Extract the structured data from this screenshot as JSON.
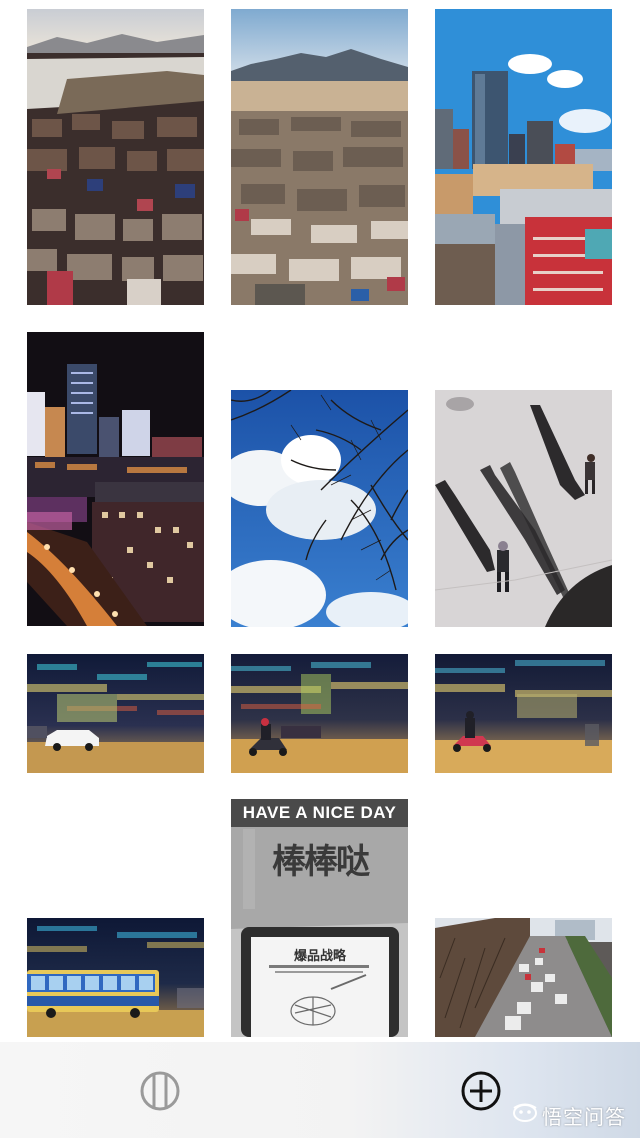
{
  "photos": [
    {
      "id": "photo-1",
      "subject": "aerial view of village rooftops by river"
    },
    {
      "id": "photo-2",
      "subject": "aerial view of town with mountains"
    },
    {
      "id": "photo-3",
      "subject": "city towers under blue sky"
    },
    {
      "id": "photo-4",
      "subject": "city street at night"
    },
    {
      "id": "photo-5",
      "subject": "bare tree branches against clouds"
    },
    {
      "id": "photo-6",
      "subject": "pedestrians with long shadows"
    },
    {
      "id": "photo-7",
      "subject": "motion-blurred street with white car"
    },
    {
      "id": "photo-8",
      "subject": "motion-blurred street with scooter"
    },
    {
      "id": "photo-9",
      "subject": "motion-blurred street with rider"
    },
    {
      "id": "photo-10",
      "subject": "motion-blurred city bus at night"
    },
    {
      "id": "photo-11",
      "subject": "paper bag and e-reader"
    },
    {
      "id": "photo-12",
      "subject": "aerial view of traffic on avenue"
    }
  ],
  "photo_texts": {
    "bag_banner": "HAVE A NICE DAY",
    "bag_title": "棒棒哒",
    "book_title": "爆品战略"
  },
  "toolbar": {
    "grid_icon": "grid-view-icon",
    "add_icon": "add-circle-icon"
  },
  "watermark": {
    "logo": "wukong-logo",
    "text": "悟空问答"
  }
}
